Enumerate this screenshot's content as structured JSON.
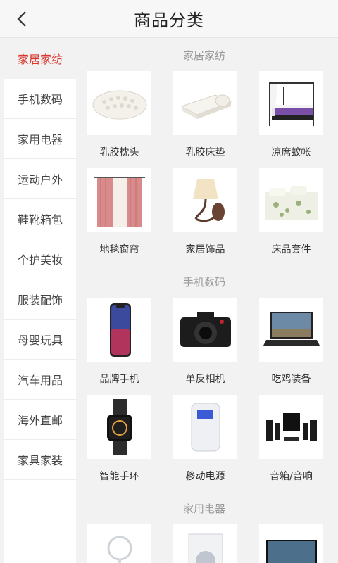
{
  "header": {
    "title": "商品分类"
  },
  "sidebar": {
    "items": [
      {
        "label": "家居家纺",
        "active": true
      },
      {
        "label": "手机数码"
      },
      {
        "label": "家用电器"
      },
      {
        "label": "运动户外"
      },
      {
        "label": "鞋靴箱包"
      },
      {
        "label": "个护美妆"
      },
      {
        "label": "服装配饰"
      },
      {
        "label": "母婴玩具"
      },
      {
        "label": "汽车用品"
      },
      {
        "label": "海外直邮"
      },
      {
        "label": "家具家装"
      }
    ]
  },
  "sections": [
    {
      "title": "家居家纺",
      "items": [
        {
          "label": "乳胶枕头",
          "icon": "latex-pillow-image"
        },
        {
          "label": "乳胶床垫",
          "icon": "latex-mattress-image"
        },
        {
          "label": "凉席蚊帐",
          "icon": "canopy-bed-image"
        },
        {
          "label": "地毯窗帘",
          "icon": "curtain-image"
        },
        {
          "label": "家居饰品",
          "icon": "wall-lamp-image"
        },
        {
          "label": "床品套件",
          "icon": "bedding-set-image"
        }
      ]
    },
    {
      "title": "手机数码",
      "items": [
        {
          "label": "品牌手机",
          "icon": "smartphone-image"
        },
        {
          "label": "单反相机",
          "icon": "camera-image"
        },
        {
          "label": "吃鸡装备",
          "icon": "gaming-laptop-image"
        },
        {
          "label": "智能手环",
          "icon": "smartwatch-image"
        },
        {
          "label": "移动电源",
          "icon": "power-bank-image"
        },
        {
          "label": "音箱/音响",
          "icon": "speaker-system-image"
        }
      ]
    },
    {
      "title": "家用电器",
      "items": [
        {
          "label": "",
          "icon": "fan-image"
        },
        {
          "label": "",
          "icon": "washing-machine-image"
        },
        {
          "label": "",
          "icon": "tv-image"
        }
      ]
    }
  ],
  "colors": {
    "accent": "#d9362c",
    "sidebar_bg": "#ffffff",
    "content_bg": "#f2f2f2"
  }
}
